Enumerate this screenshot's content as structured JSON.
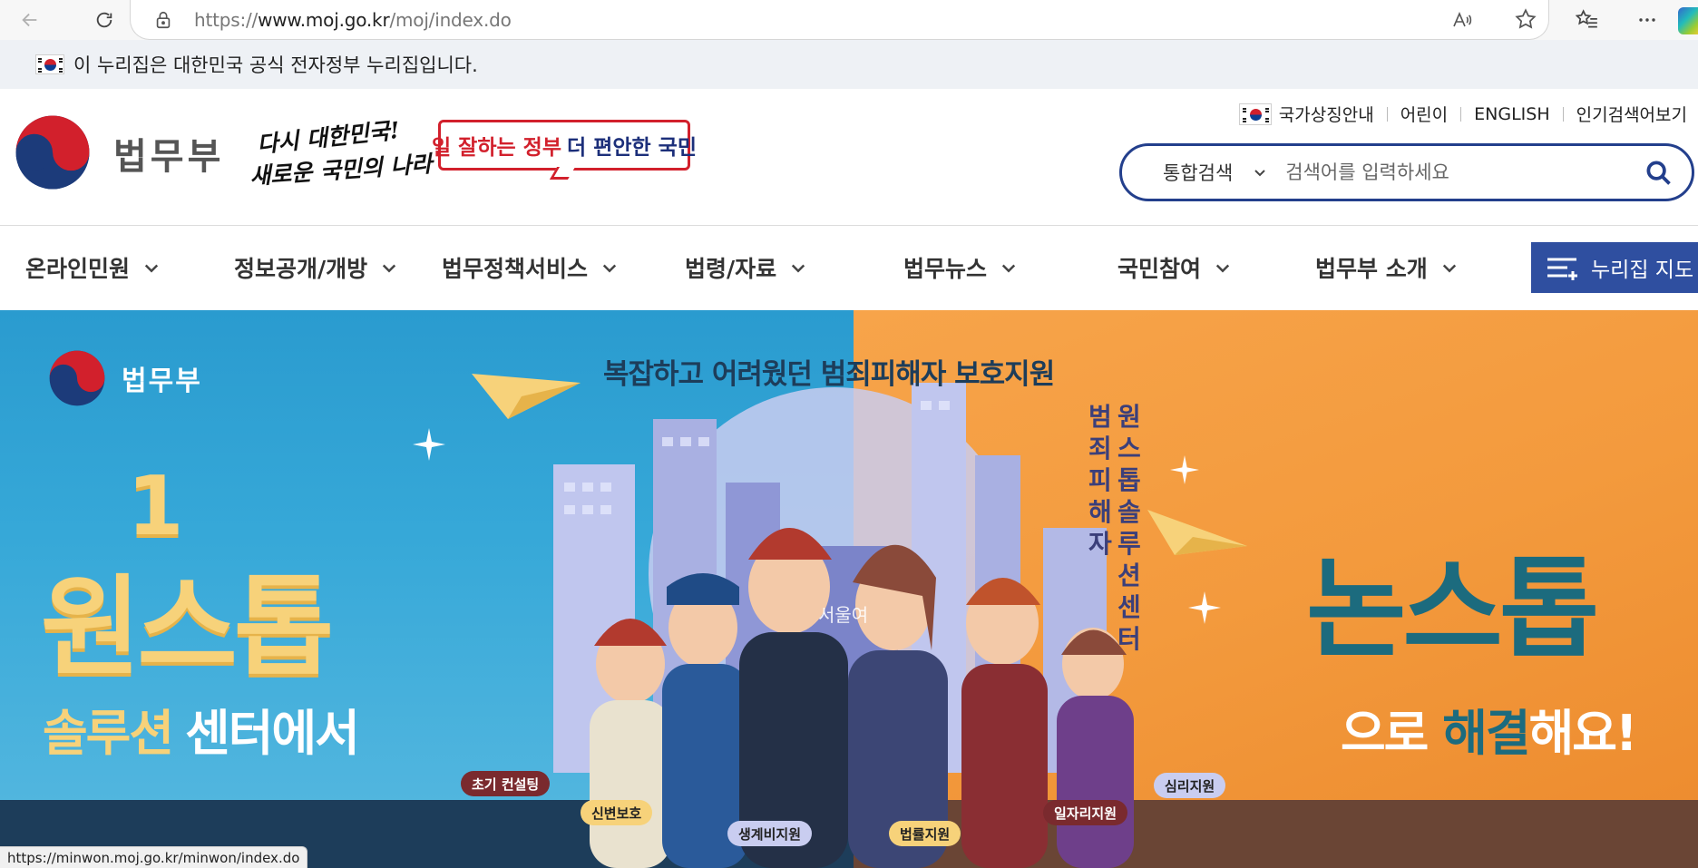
{
  "browser": {
    "url_scheme": "https://",
    "url_host": "www.moj.go.kr",
    "url_path": "/moj/index.do",
    "status_url": "https://minwon.moj.go.kr/minwon/index.do"
  },
  "gov_strip": {
    "text": "이 누리집은 대한민국 공식 전자정부 누리집입니다."
  },
  "header": {
    "logo_text": "법무부",
    "slogan_hand_line1": "다시 대한민국!",
    "slogan_hand_line2": "새로운 국민의 나라",
    "slogan_red": "일 잘하는 정부",
    "slogan_blue": "더 편안한 국민",
    "util_links": [
      "국가상징안내",
      "어린이",
      "ENGLISH",
      "인기검색어보기"
    ],
    "search": {
      "scope": "통합검색",
      "placeholder": "검색어를 입력하세요"
    }
  },
  "gnb": {
    "items": [
      "온라인민원",
      "정보공개/개방",
      "법무정책서비스",
      "법령/자료",
      "법무뉴스",
      "국민참여",
      "법무부 소개"
    ],
    "sitemap_label": "누리집 지도"
  },
  "hero": {
    "logo_text": "법무부",
    "headline": "복잡하고 어려웠던 범죄피해자 보호지원",
    "big_left": "원스톱",
    "big_left_digit": "1",
    "sub_left_yellow": "솔루션",
    "sub_left_white": "센터에서",
    "big_right": "논스톱",
    "sub_right_white1": "으로",
    "sub_right_teal": "해결",
    "sub_right_white2": "해요!",
    "vertical_left": [
      "범",
      "죄",
      "피",
      "해",
      "자"
    ],
    "vertical_right": [
      "원",
      "스",
      "톱",
      "솔",
      "루",
      "션",
      "센",
      "터"
    ],
    "seoul_sign": "서울여",
    "service_tags": [
      "초기 컨설팅",
      "신변보호",
      "생계비지원",
      "법률지원",
      "일자리지원",
      "심리지원"
    ]
  },
  "colors": {
    "navy": "#233f8c",
    "sitemap_bg": "#2f4fa0",
    "hero_left": "#2a9bcf",
    "hero_right": "#f39a3d"
  }
}
